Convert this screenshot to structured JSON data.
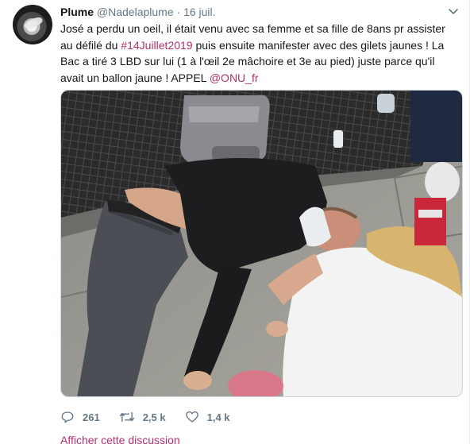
{
  "tweet": {
    "author_name": "Plume",
    "handle": "@Nadelaplume",
    "separator": "·",
    "date": "16 juil.",
    "text_part1": "José a perdu un oeil, il était venu avec sa femme et sa fille de 8ans pr assister au défilé du ",
    "hashtag": "#14Juillet2019",
    "text_part2": " puis ensuite manifester avec des gilets jaunes ! La Bac a tiré 3 LBD sur lui (1 à l'œil 2e mâchoire et 3e au pied) juste parce qu'il avait un ballon jaune ! APPEL ",
    "mention": "@ONU_fr",
    "reply_count": "261",
    "retweet_count": "2,5 k",
    "like_count": "1,4 k",
    "show_thread": "Afficher cette discussion"
  },
  "icons": {
    "reply": "reply-icon",
    "retweet": "retweet-icon",
    "like": "heart-icon",
    "menu": "chevron-down-icon",
    "avatar": "feather-avatar"
  },
  "colors": {
    "link": "#b0326e",
    "meta": "#657786",
    "text": "#14171a"
  }
}
